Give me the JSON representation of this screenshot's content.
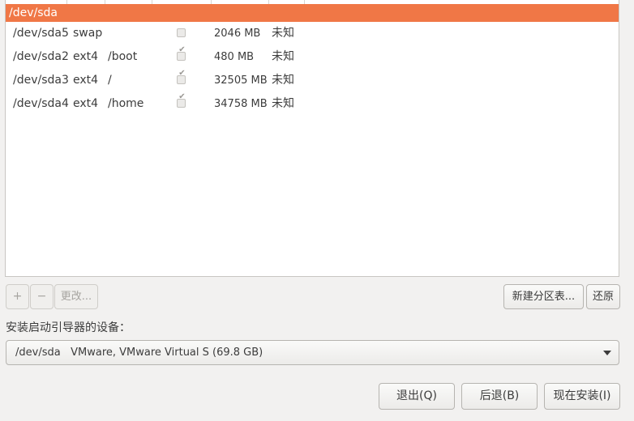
{
  "partition_table": {
    "device": {
      "label": "/dev/sda"
    },
    "partitions": [
      {
        "device": "/dev/sda5",
        "type": "swap",
        "mount": "",
        "format": false,
        "size": "2046 MB",
        "used": "未知"
      },
      {
        "device": "/dev/sda2",
        "type": "ext4",
        "mount": "/boot",
        "format": true,
        "size": "480 MB",
        "used": "未知"
      },
      {
        "device": "/dev/sda3",
        "type": "ext4",
        "mount": "/",
        "format": true,
        "size": "32505 MB",
        "used": "未知"
      },
      {
        "device": "/dev/sda4",
        "type": "ext4",
        "mount": "/home",
        "format": true,
        "size": "34758 MB",
        "used": "未知"
      }
    ]
  },
  "toolbar": {
    "add_label": "+",
    "remove_label": "−",
    "change_label": "更改...",
    "new_table_label": "新建分区表...",
    "revert_label": "还原"
  },
  "bootloader": {
    "label": "安装启动引导器的设备：",
    "selected_device": "/dev/sda",
    "selected_description": "VMware, VMware Virtual S (69.8 GB)"
  },
  "actions": {
    "quit_label": "退出(Q)",
    "back_label": "后退(B)",
    "install_label": "现在安装(I)"
  },
  "colors": {
    "selected_row": "#f07746",
    "window_bg": "#f2f1f0"
  },
  "icons": {
    "format_checkbox": "check-icon",
    "combo_arrow": "dropdown-arrow-icon"
  }
}
